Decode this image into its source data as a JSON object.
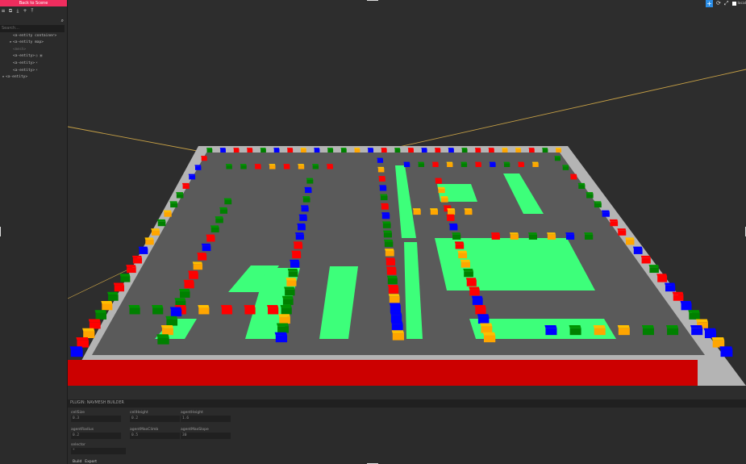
{
  "sidebar": {
    "back_label": "Back to Scene",
    "search_placeholder": "Search...",
    "toolbar_icons": [
      "layers-icon",
      "copy-icon",
      "download-icon",
      "add-icon",
      "upload-icon"
    ],
    "tree": [
      {
        "label": "<a-scene>",
        "depth": 0,
        "caret": "▾",
        "dim": false,
        "tags": ""
      },
      {
        "label": "<a-entity container>",
        "depth": 1,
        "caret": "",
        "dim": false,
        "tags": ""
      },
      {
        "label": "<a-entity map>",
        "depth": 1,
        "caret": "▸",
        "dim": false,
        "tags": ""
      },
      {
        "label": "<mesh>",
        "depth": 1,
        "caret": "",
        "dim": true,
        "tags": ""
      },
      {
        "label": "<a-entity>",
        "depth": 1,
        "caret": "",
        "dim": false,
        "tags": "◎ ▣"
      },
      {
        "label": "<a-entity>",
        "depth": 1,
        "caret": "",
        "dim": false,
        "tags": "☀"
      },
      {
        "label": "<a-entity>",
        "depth": 1,
        "caret": "",
        "dim": false,
        "tags": "☀"
      },
      {
        "label": "<a-entity>",
        "depth": 0,
        "caret": "▸",
        "dim": false,
        "tags": ""
      }
    ]
  },
  "viewport": {
    "toolbar": {
      "add": "+",
      "refresh": "⟳",
      "fullscreen": "⤢",
      "toggle_label": "local"
    }
  },
  "panel": {
    "title": "PLUGIN: NAVMESH BUILDER",
    "fields": [
      {
        "label": "cellSize",
        "value": "0.3"
      },
      {
        "label": "cellHeight",
        "value": "0.2"
      },
      {
        "label": "agentHeight",
        "value": "1.6"
      },
      {
        "label": "agentRadius",
        "value": "0.2"
      },
      {
        "label": "agentMaxClimb",
        "value": "0.5"
      },
      {
        "label": "agentMaxSlope",
        "value": "30"
      },
      {
        "label": "selector",
        "value": "*"
      }
    ],
    "buttons": [
      "Build",
      "Export"
    ]
  },
  "colors": {
    "red": "#ff0000",
    "green": "#008000",
    "blue": "#0000ff",
    "orange": "#ffa500",
    "navmesh": "#3dff7a",
    "ground": "#b0b0b0",
    "road": "#555555",
    "accent": "#ef2d5e"
  }
}
